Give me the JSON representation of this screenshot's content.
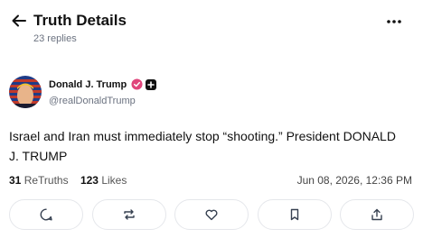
{
  "header": {
    "title": "Truth Details",
    "subtitle": "23 replies"
  },
  "author": {
    "name": "Donald J. Trump",
    "handle": "@realDonaldTrump",
    "verified_color": "#e0457b"
  },
  "post": {
    "text": "Israel and Iran must immediately stop “shooting.” President DONALD J. TRUMP"
  },
  "stats": {
    "retruths_count": "31",
    "retruths_label": "ReTruths",
    "likes_count": "123",
    "likes_label": "Likes",
    "timestamp": "Jun 08, 2026, 12:36 PM"
  },
  "actions": {
    "icons": [
      "reply-icon",
      "retruth-icon",
      "like-icon",
      "bookmark-icon",
      "share-icon"
    ]
  }
}
